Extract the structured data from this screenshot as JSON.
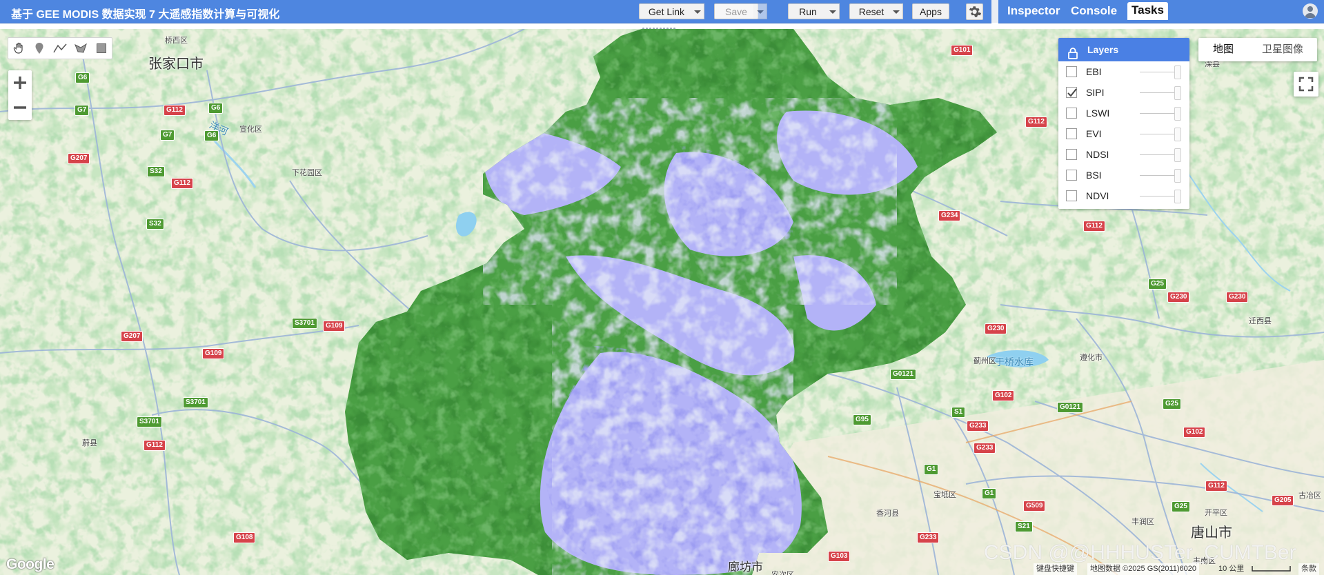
{
  "script": {
    "title": "基于 GEE MODIS 数据实现 7 大遥感指数计算与可视化"
  },
  "toolbar": {
    "get_link": "Get Link",
    "save": "Save",
    "run": "Run",
    "reset": "Reset",
    "apps": "Apps"
  },
  "tabs": [
    "Inspector",
    "Console",
    "Tasks"
  ],
  "active_tab": "Tasks",
  "layers_panel": {
    "title": "Layers",
    "layers": [
      {
        "name": "EBI",
        "checked": false
      },
      {
        "name": "SIPI",
        "checked": true
      },
      {
        "name": "LSWI",
        "checked": false
      },
      {
        "name": "EVI",
        "checked": false
      },
      {
        "name": "NDSI",
        "checked": false
      },
      {
        "name": "BSI",
        "checked": false
      },
      {
        "name": "NDVI",
        "checked": false
      }
    ]
  },
  "map_type": {
    "map": "地图",
    "satellite": "卫星图像",
    "selected": "地图"
  },
  "places": {
    "cities": [
      "张家口市",
      "唐山市",
      "廊坊市"
    ],
    "districts": [
      "桥西区",
      "宣化区",
      "下花园区",
      "蔚县",
      "香河县",
      "宝坻区",
      "蓟州区",
      "遵化市",
      "迁西县",
      "开平区",
      "丰润区",
      "古冶区",
      "丰南区",
      "滦县",
      "安次区"
    ],
    "water": [
      "洋河",
      "于桥水库"
    ]
  },
  "roads": [
    "G6",
    "G7",
    "G112",
    "G207",
    "S32",
    "G6",
    "G7",
    "G6",
    "G112",
    "S32",
    "G207",
    "G109",
    "S3701",
    "G109",
    "S3701",
    "S3701",
    "G112",
    "G108",
    "G101",
    "G112",
    "G234",
    "G112",
    "G25",
    "G230",
    "G230",
    "G230",
    "G0121",
    "G102",
    "G0121",
    "G25",
    "G95",
    "S1",
    "G233",
    "G233",
    "G1",
    "G1",
    "G102",
    "G509",
    "S21",
    "G233",
    "G103",
    "G25",
    "G205",
    "G112"
  ],
  "footer": {
    "google": "Google",
    "shortcuts": "键盘快捷键",
    "map_data": "地图数据 ©2025 GS(2011)6020",
    "scale": "10 公里",
    "terms": "条款",
    "watermark": "CSDN @@HHHUSTer_CUMTBer"
  },
  "colors": {
    "topbar": "#4e86e0",
    "layers_header": "#4a80e4",
    "ndvi_green": "#3f9a3a",
    "low_index_purple": "#a7a7f5",
    "road_red": "#d6434a",
    "road_green": "#4e9a32"
  }
}
